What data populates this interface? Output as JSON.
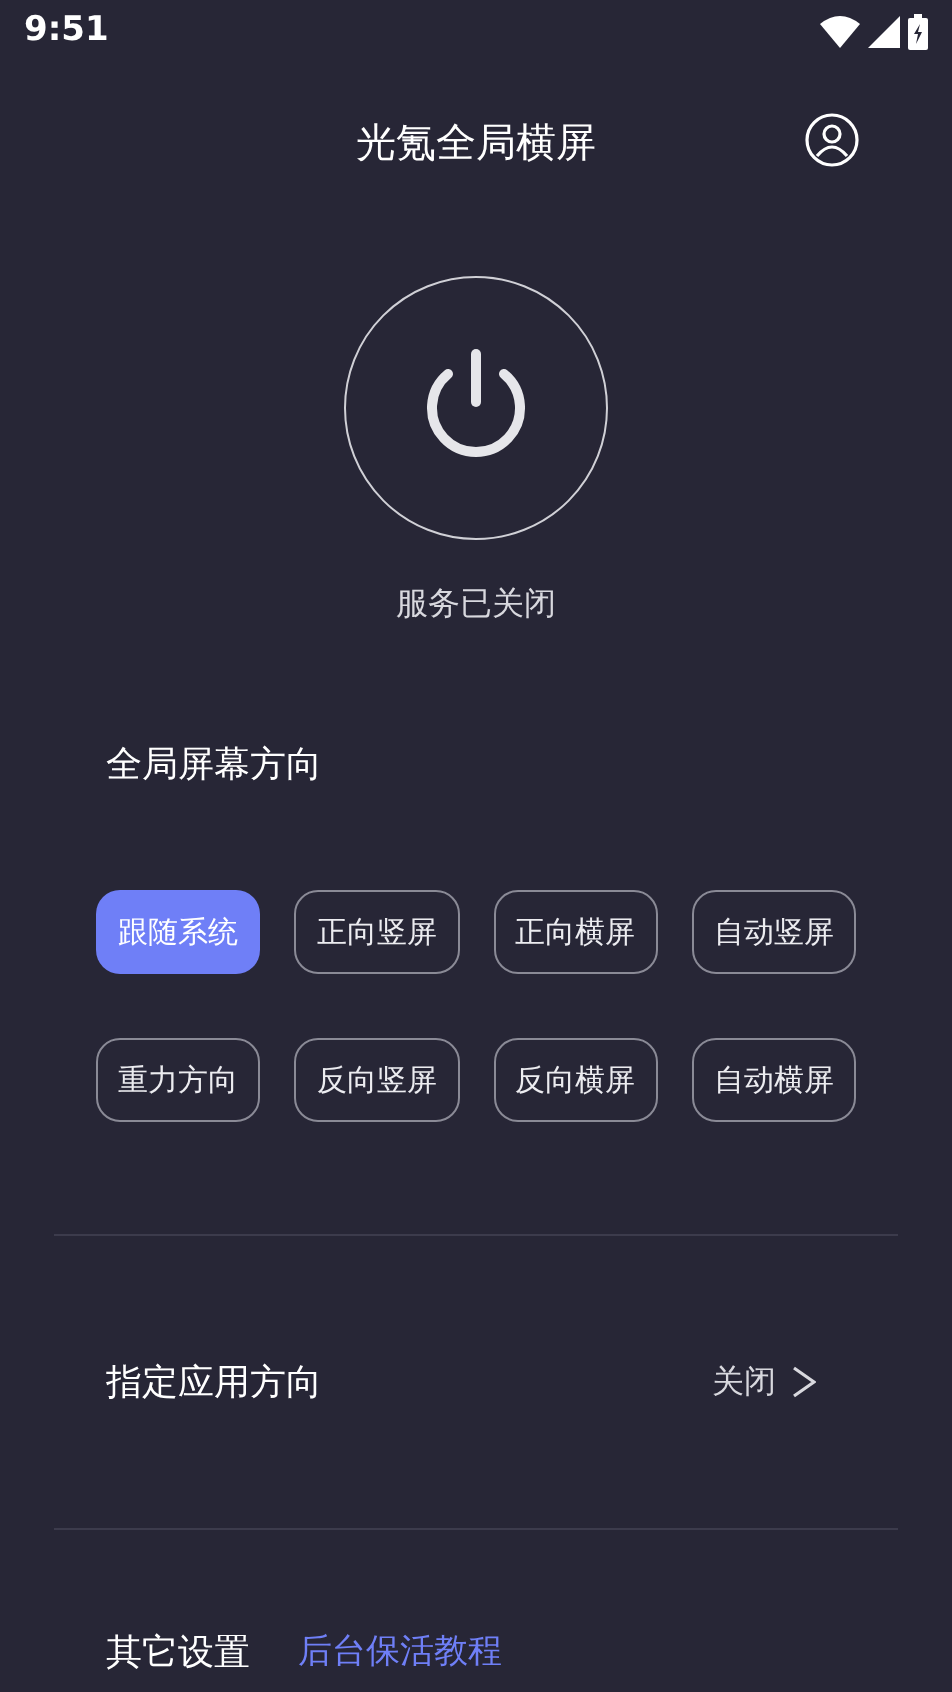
{
  "status_bar": {
    "time": "9:51"
  },
  "header": {
    "title": "光氪全局横屏"
  },
  "service": {
    "on": false,
    "status": "服务已关闭"
  },
  "orientation": {
    "title": "全局屏幕方向",
    "options": [
      {
        "label": "跟随系统",
        "selected": true
      },
      {
        "label": "正向竖屏",
        "selected": false
      },
      {
        "label": "正向横屏",
        "selected": false
      },
      {
        "label": "自动竖屏",
        "selected": false
      },
      {
        "label": "重力方向",
        "selected": false
      },
      {
        "label": "反向竖屏",
        "selected": false
      },
      {
        "label": "反向横屏",
        "selected": false
      },
      {
        "label": "自动横屏",
        "selected": false
      }
    ]
  },
  "app_orientation": {
    "label": "指定应用方向",
    "value": "关闭"
  },
  "other": {
    "label": "其它设置",
    "link": "后台保活教程"
  }
}
